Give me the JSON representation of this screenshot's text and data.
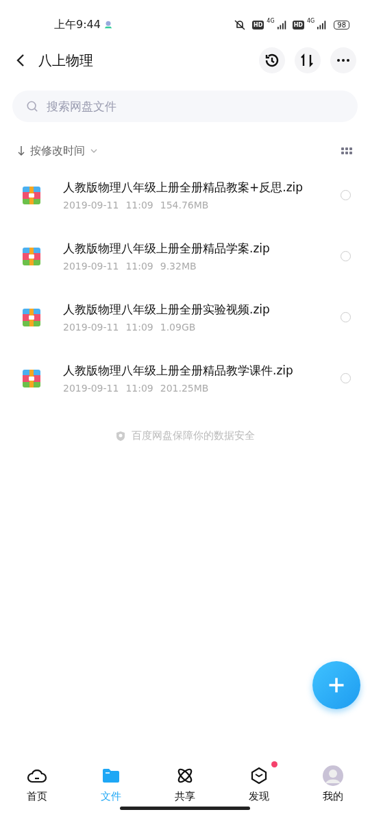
{
  "status_bar": {
    "time": "上午9:44",
    "sim1": {
      "hd": "HD",
      "net": "4G"
    },
    "sim2": {
      "hd": "HD",
      "net": "4G"
    },
    "battery": "98"
  },
  "header": {
    "title": "八上物理"
  },
  "search": {
    "placeholder": "搜索网盘文件"
  },
  "sort": {
    "label": "按修改时间"
  },
  "files": [
    {
      "name": "人教版物理八年级上册全册精品教案+反思.zip",
      "date": "2019-09-11",
      "time": "11:09",
      "size": "154.76MB",
      "selected": false
    },
    {
      "name": "人教版物理八年级上册全册精品学案.zip",
      "date": "2019-09-11",
      "time": "11:09",
      "size": "9.32MB",
      "selected": false
    },
    {
      "name": "人教版物理八年级上册全册实验视频.zip",
      "date": "2019-09-11",
      "time": "11:09",
      "size": "1.09GB",
      "selected": false
    },
    {
      "name": "人教版物理八年级上册全册精品教学课件.zip",
      "date": "2019-09-11",
      "time": "11:09",
      "size": "201.25MB",
      "selected": false
    }
  ],
  "footer_note": "百度网盘保障你的数据安全",
  "tabs": [
    {
      "kind": "home",
      "label": "首页",
      "selected": false,
      "dot": false
    },
    {
      "kind": "files",
      "label": "文件",
      "selected": true,
      "dot": false
    },
    {
      "kind": "share",
      "label": "共享",
      "selected": false,
      "dot": false
    },
    {
      "kind": "discover",
      "label": "发现",
      "selected": false,
      "dot": true
    },
    {
      "kind": "me",
      "label": "我的",
      "selected": false,
      "dot": false
    }
  ]
}
